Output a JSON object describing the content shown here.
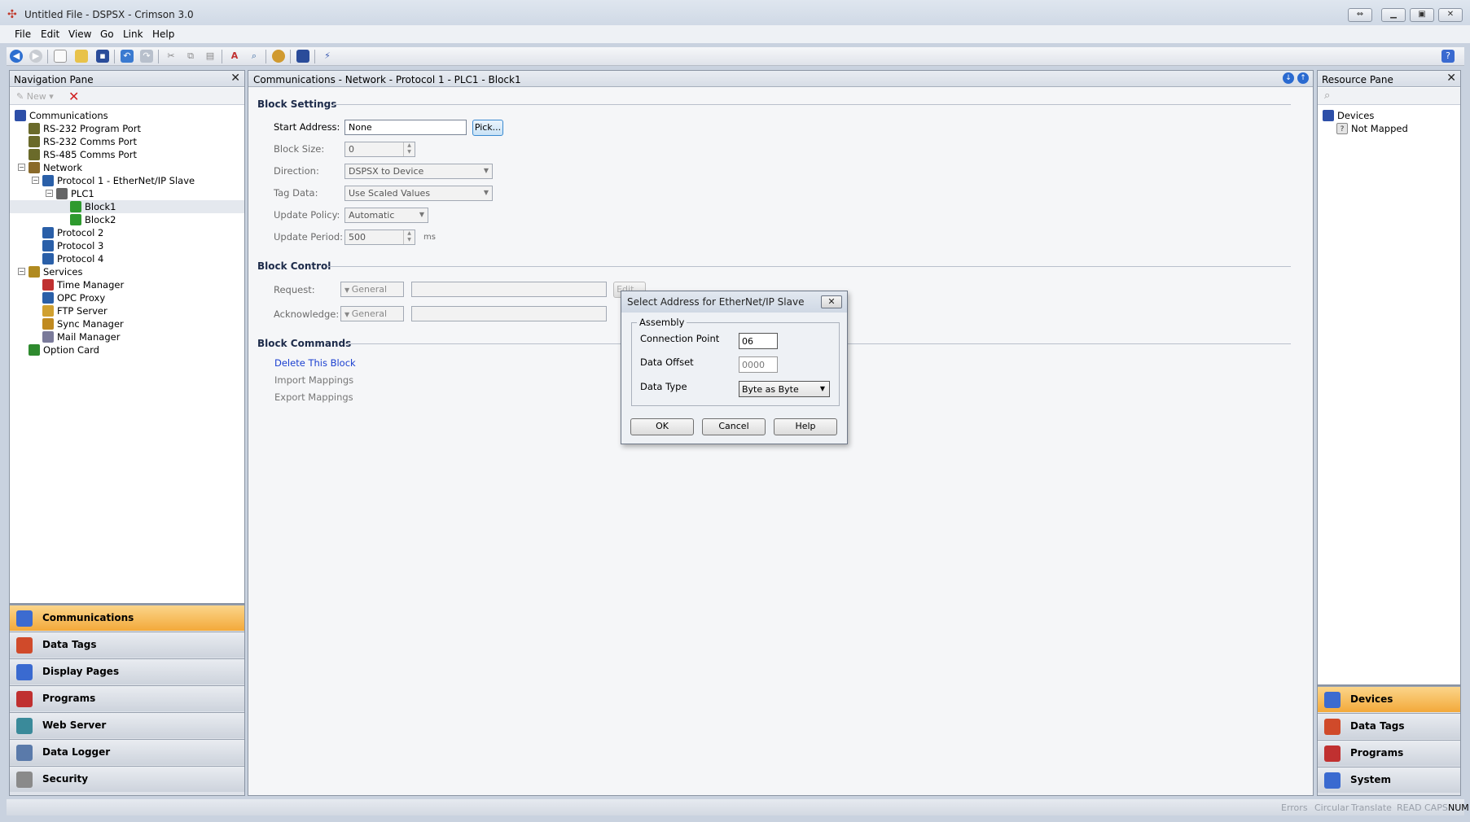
{
  "window": {
    "title": "Untitled File - DSPSX - Crimson 3.0"
  },
  "menu": [
    "File",
    "Edit",
    "View",
    "Go",
    "Link",
    "Help"
  ],
  "nav_pane": {
    "title": "Navigation Pane",
    "new_label": "New",
    "tree": [
      {
        "label": "Communications",
        "level": 0,
        "icon": "comms-icon",
        "color": "#2d4fa8"
      },
      {
        "label": "RS-232 Program Port",
        "level": 1,
        "icon": "port-icon",
        "color": "#6a6a2a"
      },
      {
        "label": "RS-232 Comms Port",
        "level": 1,
        "icon": "port-icon",
        "color": "#6a6a2a"
      },
      {
        "label": "RS-485 Comms Port",
        "level": 1,
        "icon": "port-icon",
        "color": "#6a6a2a"
      },
      {
        "label": "Network",
        "level": 1,
        "icon": "network-icon",
        "color": "#8a6a2a",
        "expander": "−"
      },
      {
        "label": "Protocol 1 - EtherNet/IP Slave",
        "level": 2,
        "icon": "protocol-icon",
        "color": "#2a5fa8",
        "expander": "−"
      },
      {
        "label": "PLC1",
        "level": 3,
        "icon": "plc-icon",
        "color": "#666",
        "expander": "−"
      },
      {
        "label": "Block1",
        "level": 4,
        "icon": "block-icon",
        "color": "#2e9a2e",
        "selected": true
      },
      {
        "label": "Block2",
        "level": 4,
        "icon": "block-icon",
        "color": "#2e9a2e"
      },
      {
        "label": "Protocol 2",
        "level": 2,
        "icon": "protocol-icon",
        "color": "#2a5fa8"
      },
      {
        "label": "Protocol 3",
        "level": 2,
        "icon": "protocol-icon",
        "color": "#2a5fa8"
      },
      {
        "label": "Protocol 4",
        "level": 2,
        "icon": "protocol-icon",
        "color": "#2a5fa8"
      },
      {
        "label": "Services",
        "level": 1,
        "icon": "services-icon",
        "color": "#b08a20",
        "expander": "−"
      },
      {
        "label": "Time Manager",
        "level": 2,
        "icon": "clock-icon",
        "color": "#c03030"
      },
      {
        "label": "OPC Proxy",
        "level": 2,
        "icon": "opc-icon",
        "color": "#2a5fa8"
      },
      {
        "label": "FTP Server",
        "level": 2,
        "icon": "ftp-icon",
        "color": "#d0a030"
      },
      {
        "label": "Sync Manager",
        "level": 2,
        "icon": "sync-icon",
        "color": "#c08a20"
      },
      {
        "label": "Mail Manager",
        "level": 2,
        "icon": "mail-icon",
        "color": "#7a7a9a"
      },
      {
        "label": "Option Card",
        "level": 1,
        "icon": "card-icon",
        "color": "#2e8a2e"
      }
    ],
    "categories": [
      {
        "label": "Communications",
        "icon": "comms-icon",
        "color": "#3c6bd0",
        "active": true
      },
      {
        "label": "Data Tags",
        "icon": "tags-icon",
        "color": "#d04a2a"
      },
      {
        "label": "Display Pages",
        "icon": "pages-icon",
        "color": "#3a6ad0"
      },
      {
        "label": "Programs",
        "icon": "programs-icon",
        "color": "#c03030"
      },
      {
        "label": "Web Server",
        "icon": "web-icon",
        "color": "#3a8a9a"
      },
      {
        "label": "Data Logger",
        "icon": "logger-icon",
        "color": "#5a7aaa"
      },
      {
        "label": "Security",
        "icon": "security-icon",
        "color": "#8a8a8a"
      }
    ]
  },
  "main": {
    "breadcrumb": "Communications - Network - Protocol 1 - PLC1 - Block1",
    "settings": {
      "title": "Block Settings",
      "start_address_label": "Start Address:",
      "start_address": "None",
      "pick_label": "Pick...",
      "block_size_label": "Block Size:",
      "block_size": "0",
      "direction_label": "Direction:",
      "direction": "DSPSX to Device",
      "tag_data_label": "Tag Data:",
      "tag_data": "Use Scaled Values",
      "update_policy_label": "Update Policy:",
      "update_policy": "Automatic",
      "update_period_label": "Update Period:",
      "update_period": "500",
      "update_period_unit": "ms"
    },
    "control": {
      "title": "Block Control",
      "request_label": "Request:",
      "acknowledge_label": "Acknowledge:",
      "general_label": "General",
      "edit_label": "Edit..."
    },
    "commands": {
      "title": "Block Commands",
      "delete": "Delete This Block",
      "import": "Import Mappings",
      "export": "Export Mappings"
    }
  },
  "dialog": {
    "title": "Select Address for EtherNet/IP Slave",
    "group": "Assembly",
    "connection_point_label": "Connection Point",
    "connection_point": "06",
    "data_offset_label": "Data Offset",
    "data_offset": "0000",
    "data_type_label": "Data Type",
    "data_type": "Byte as Byte",
    "ok": "OK",
    "cancel": "Cancel",
    "help": "Help"
  },
  "resource_pane": {
    "title": "Resource Pane",
    "tree": [
      {
        "label": "Devices"
      },
      {
        "label": "Not Mapped"
      }
    ],
    "categories": [
      {
        "label": "Devices",
        "color": "#3c6bd0",
        "active": true
      },
      {
        "label": "Data Tags",
        "color": "#d04a2a"
      },
      {
        "label": "Programs",
        "color": "#c03030"
      },
      {
        "label": "System",
        "color": "#3a6ad0"
      }
    ]
  },
  "status": [
    "Errors",
    "Circular",
    "Translate",
    "READ",
    "CAPS",
    "NUM"
  ]
}
